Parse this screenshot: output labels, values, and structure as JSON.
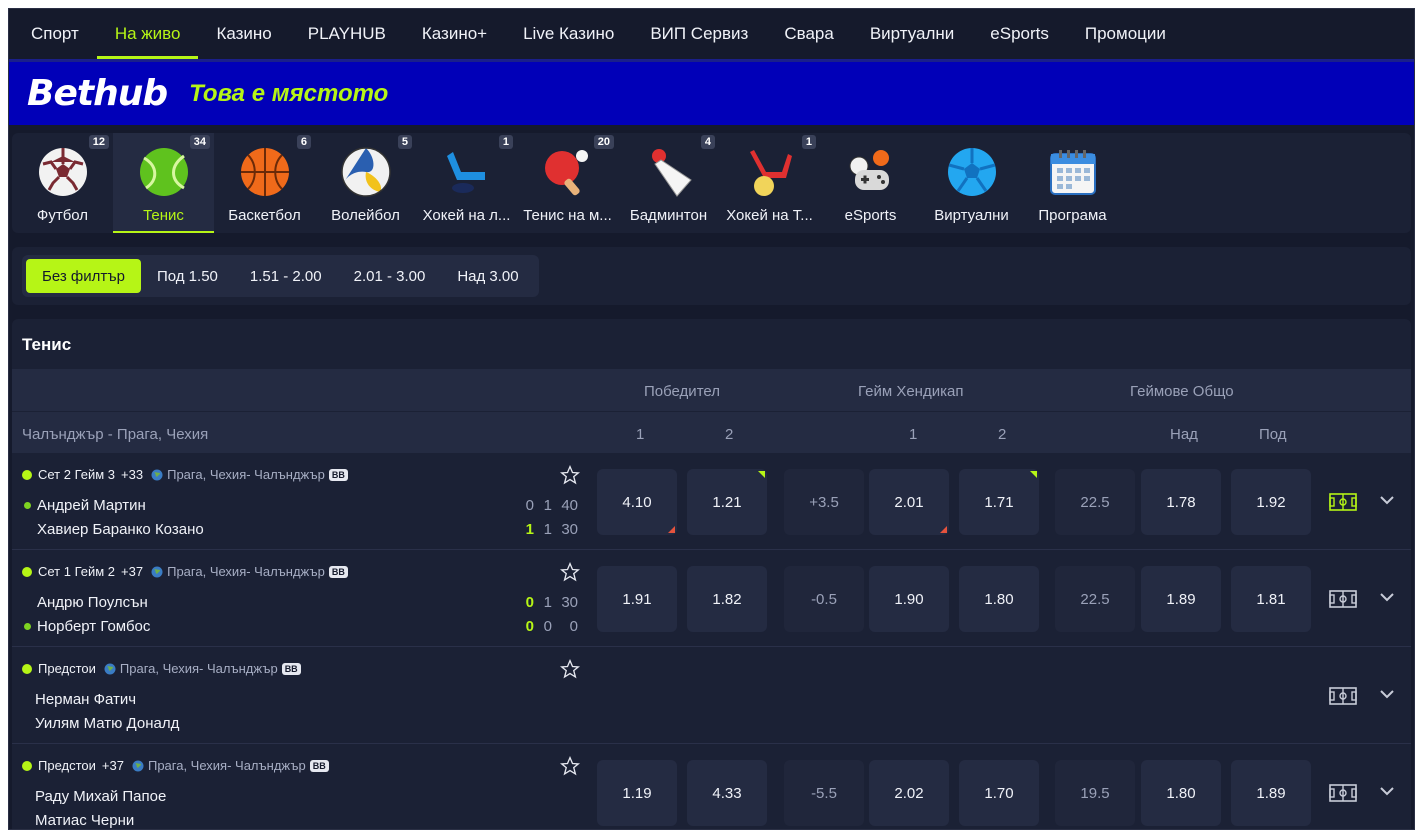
{
  "nav": [
    "Спорт",
    "На живо",
    "Казино",
    "PLAYHUB",
    "Казино+",
    "Live Казино",
    "ВИП Сервиз",
    "Свара",
    "Виртуални",
    "eSports",
    "Промоции"
  ],
  "banner": {
    "logo": "Bethub",
    "tagline": "Това е мястото"
  },
  "sports": [
    {
      "label": "Футбол",
      "count": "12",
      "icon": "football-icon"
    },
    {
      "label": "Тенис",
      "count": "34",
      "icon": "tennis-icon"
    },
    {
      "label": "Баскетбол",
      "count": "6",
      "icon": "basketball-icon"
    },
    {
      "label": "Волейбол",
      "count": "5",
      "icon": "volleyball-icon"
    },
    {
      "label": "Хокей на л...",
      "count": "1",
      "icon": "ice-hockey-icon"
    },
    {
      "label": "Тенис на м...",
      "count": "20",
      "icon": "table-tennis-icon"
    },
    {
      "label": "Бадминтон",
      "count": "4",
      "icon": "badminton-icon"
    },
    {
      "label": "Хокей на Т...",
      "count": "1",
      "icon": "field-hockey-icon"
    },
    {
      "label": "eSports",
      "count": "",
      "icon": "esports-icon"
    },
    {
      "label": "Виртуални",
      "count": "",
      "icon": "virtual-icon"
    },
    {
      "label": "Програма",
      "count": "",
      "icon": "calendar-icon"
    }
  ],
  "filters": [
    "Без филтър",
    "Под 1.50",
    "1.51 - 2.00",
    "2.01 - 3.00",
    "Над 3.00"
  ],
  "section_title": "Тенис",
  "markets": {
    "winner": "Победител",
    "handicap": "Гейм Хендикап",
    "total": "Геймове Общо"
  },
  "league": {
    "name": "Чалънджър - Прага, Чехия",
    "c1": "1",
    "c2": "2",
    "h1": "1",
    "h2": "2",
    "over": "Над",
    "under": "Под"
  },
  "events": [
    {
      "status": "Сет 2 Гейм 3",
      "plus": "+33",
      "location": "Прага, Чехия- Чалънджър",
      "badge": "BB",
      "p1": "Андрей Мартин",
      "p2": "Хавиер Баранко Козано",
      "s1": [
        "0",
        "1",
        "40"
      ],
      "s2": [
        "1",
        "1",
        "30"
      ],
      "odds": [
        "4.10",
        "1.21",
        "+3.5",
        "2.01",
        "1.71",
        "22.5",
        "1.78",
        "1.92"
      ]
    },
    {
      "status": "Сет 1 Гейм 2",
      "plus": "+37",
      "location": "Прага, Чехия- Чалънджър",
      "badge": "BB",
      "p1": "Андрю Поулсън",
      "p2": "Норберт Гомбос",
      "s1": [
        "0",
        "1",
        "30"
      ],
      "s2": [
        "0",
        "0",
        "0"
      ],
      "odds": [
        "1.91",
        "1.82",
        "-0.5",
        "1.90",
        "1.80",
        "22.5",
        "1.89",
        "1.81"
      ]
    },
    {
      "status": "Предстои",
      "plus": "",
      "location": "Прага, Чехия- Чалънджър",
      "badge": "BB",
      "p1": "Нерман Фатич",
      "p2": "Уилям Матю Доналд"
    },
    {
      "status": "Предстои",
      "plus": "+37",
      "location": "Прага, Чехия- Чалънджър",
      "badge": "BB",
      "p1": "Раду Михай Папое",
      "p2": "Матиас Черни",
      "odds": [
        "1.19",
        "4.33",
        "-5.5",
        "2.02",
        "1.70",
        "19.5",
        "1.80",
        "1.89"
      ]
    }
  ],
  "colors": {
    "accent": "#b6f516",
    "bg": "#151a2c",
    "banner": "#0100b8"
  }
}
